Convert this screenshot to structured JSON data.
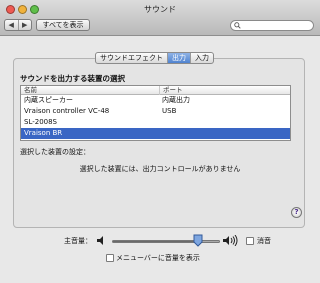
{
  "window": {
    "title": "サウンド"
  },
  "toolbar": {
    "back_icon": "back-arrow-icon",
    "forward_icon": "forward-arrow-icon",
    "show_all_label": "すべてを表示",
    "search_placeholder": ""
  },
  "tabs": [
    {
      "label": "サウンドエフェクト",
      "active": false
    },
    {
      "label": "出力",
      "active": true
    },
    {
      "label": "入力",
      "active": false
    }
  ],
  "output": {
    "section_title": "サウンドを出力する装置の選択",
    "columns": [
      "名前",
      "ポート"
    ],
    "devices": [
      {
        "name": "内蔵スピーカー",
        "port": "内蔵出力",
        "selected": false
      },
      {
        "name": "Vraison controller VC-48",
        "port": "USB",
        "selected": false
      },
      {
        "name": "SL-2008S",
        "port": "",
        "selected": false
      },
      {
        "name": "Vraison BR",
        "port": "",
        "selected": true
      }
    ],
    "selected_settings_label": "選択した装置の設定：",
    "no_controls_message": "選択した装置には、出力コントロールがありません"
  },
  "help": {
    "label": "?"
  },
  "volume": {
    "label": "主音量：",
    "level": 0.8,
    "mute_label": "消音",
    "muted": false,
    "show_in_menubar_label": "メニューバーに音量を表示",
    "show_in_menubar": false
  },
  "colors": {
    "selection": "#3a66c4",
    "active_tab": "#4f83d0"
  }
}
